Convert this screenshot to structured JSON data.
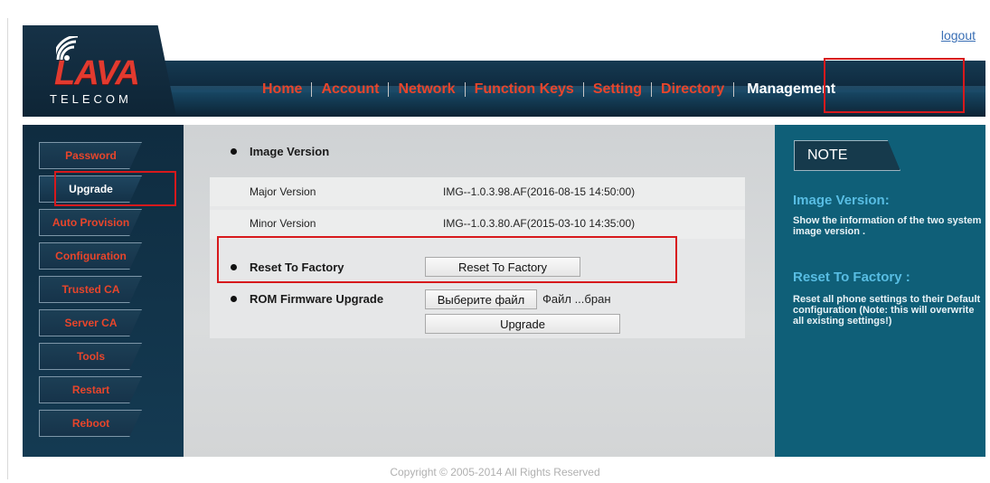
{
  "header": {
    "logout_label": "logout",
    "logo_text": "LAVA",
    "logo_subtext": "TELECOM",
    "nav": [
      {
        "label": "Home"
      },
      {
        "label": "Account"
      },
      {
        "label": "Network"
      },
      {
        "label": "Function Keys"
      },
      {
        "label": "Setting"
      },
      {
        "label": "Directory"
      },
      {
        "label": "Management",
        "active": true
      }
    ]
  },
  "sidebar": {
    "items": [
      {
        "label": "Password"
      },
      {
        "label": "Upgrade",
        "active": true
      },
      {
        "label": "Auto Provision"
      },
      {
        "label": "Configuration"
      },
      {
        "label": "Trusted CA"
      },
      {
        "label": "Server CA"
      },
      {
        "label": "Tools"
      },
      {
        "label": "Restart"
      },
      {
        "label": "Reboot"
      }
    ]
  },
  "main": {
    "image_version": {
      "heading": "Image Version",
      "major_label": "Major Version",
      "major_value": "IMG--1.0.3.98.AF(2016-08-15 14:50:00)",
      "minor_label": "Minor Version",
      "minor_value": "IMG--1.0.3.80.AF(2015-03-10 14:35:00)"
    },
    "reset": {
      "label": "Reset To Factory",
      "button_label": "Reset To Factory"
    },
    "rom": {
      "label": "ROM Firmware Upgrade",
      "choose_file_label": "Выберите файл",
      "file_status": "Файл ...бран",
      "upgrade_label": "Upgrade"
    }
  },
  "note": {
    "tab_label": "NOTE",
    "image_version_title": "Image Version:",
    "image_version_text": "Show the information of the two system image version .",
    "reset_title": "Reset To Factory :",
    "reset_text": "Reset all phone settings to their Default configuration (Note: this will overwrite all existing settings!)"
  },
  "footer": {
    "copyright": "Copyright © 2005-2014 All Rights Reserved"
  },
  "colors": {
    "accent_red": "#e8452b",
    "header_navy": "#0f2b40",
    "note_teal": "#0f5f78",
    "note_heading": "#58bde3",
    "highlight_box": "#d7191c"
  }
}
